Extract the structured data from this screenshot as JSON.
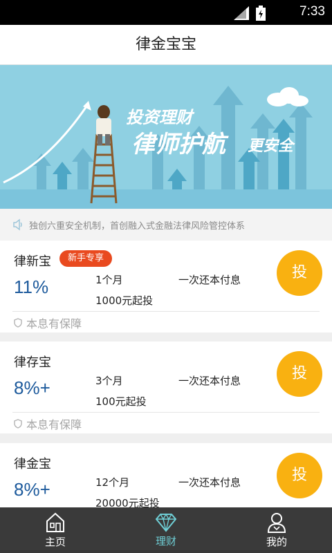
{
  "status_bar": {
    "time": "7:33"
  },
  "header": {
    "title": "律金宝宝"
  },
  "banner": {
    "line1": "投资理财",
    "line2": "律师护航",
    "line3": "更安全"
  },
  "notice": {
    "text": "独创六重安全机制，首创融入式金融法律风险管控体系"
  },
  "products": [
    {
      "name": "律新宝",
      "tag": "新手专享",
      "rate": "11%",
      "term": "1个月",
      "min": "1000元起投",
      "method": "一次还本付息",
      "invest_label": "投",
      "guarantee": "本息有保障"
    },
    {
      "name": "律存宝",
      "rate": "8%+",
      "term": "3个月",
      "min": "100元起投",
      "method": "一次还本付息",
      "invest_label": "投",
      "guarantee": "本息有保障"
    },
    {
      "name": "律金宝",
      "rate": "8%+",
      "term": "12个月",
      "min": "20000元起投",
      "method": "一次还本付息",
      "invest_label": "投"
    }
  ],
  "tabs": [
    {
      "label": "主页",
      "icon": "home-icon"
    },
    {
      "label": "理财",
      "icon": "diamond-icon",
      "active": true
    },
    {
      "label": "我的",
      "icon": "user-icon"
    }
  ],
  "colors": {
    "accent_blue": "#1d5a9c",
    "invest_yellow": "#f9b111",
    "tag_red": "#e94a1f",
    "tab_active": "#6fcfd6",
    "banner_sky": "#8fd0e2"
  }
}
